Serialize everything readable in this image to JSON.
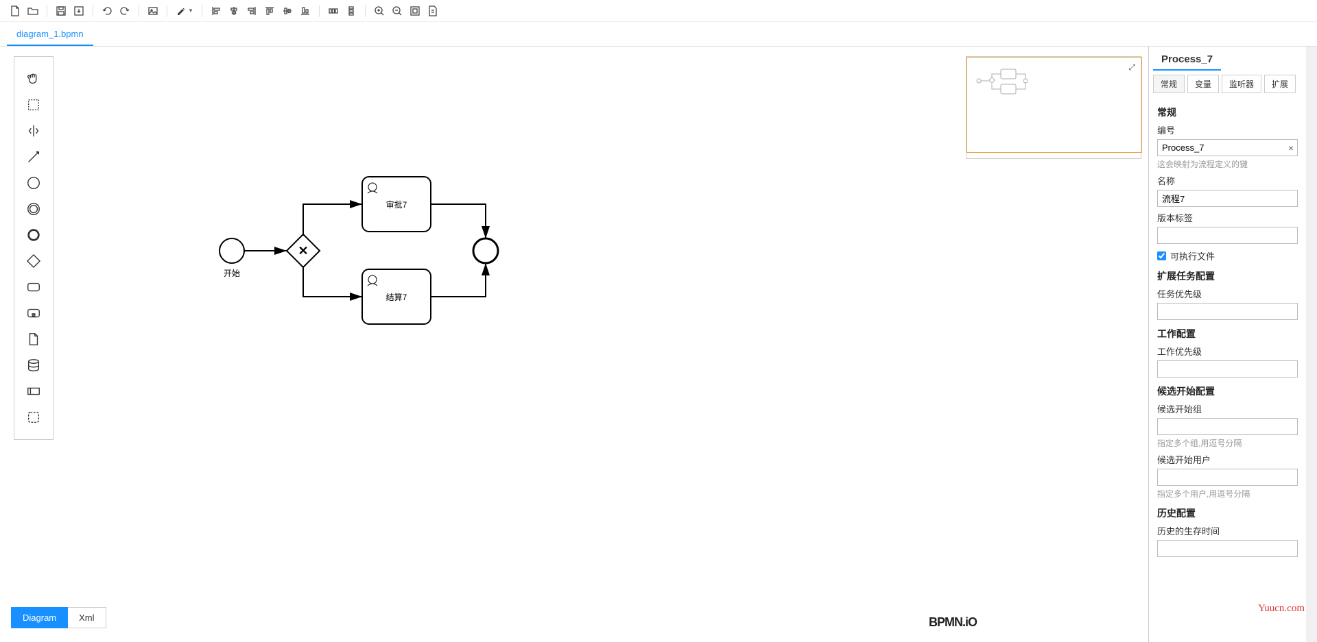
{
  "file_tab": "diagram_1.bpmn",
  "toolbar_icons": [
    "new-file",
    "open-file",
    "save",
    "download",
    "undo",
    "redo",
    "image",
    "paint",
    "align-left",
    "align-center-h",
    "align-right",
    "align-top",
    "align-center-v",
    "align-bottom",
    "distribute-h",
    "distribute-v",
    "zoom-in",
    "zoom-out",
    "fit",
    "page"
  ],
  "palette_icons": [
    "hand-tool",
    "lasso-tool",
    "space-tool",
    "connect-tool",
    "start-event",
    "intermediate-event",
    "end-event",
    "gateway",
    "task",
    "subprocess",
    "data-object",
    "data-store",
    "participant",
    "group"
  ],
  "bpmn": {
    "start_label": "开始",
    "task1": "审批7",
    "task2": "结算7"
  },
  "props": {
    "title": "Process_7",
    "tabs": [
      "常规",
      "变量",
      "监听器",
      "扩展"
    ],
    "h_general": "常规",
    "lbl_id": "编号",
    "val_id": "Process_7",
    "hint_id": "这会映射为流程定义的键",
    "lbl_name": "名称",
    "val_name": "流程7",
    "lbl_version": "版本标签",
    "lbl_exec": "可执行文件",
    "h_ext": "扩展任务配置",
    "lbl_task_prio": "任务优先级",
    "h_job": "工作配置",
    "lbl_job_prio": "工作优先级",
    "h_cand_start": "候选开始配置",
    "lbl_cand_group": "候选开始组",
    "hint_cand_group": "指定多个组,用逗号分隔",
    "lbl_cand_user": "候选开始用户",
    "hint_cand_user": "指定多个用户,用逗号分隔",
    "h_history": "历史配置",
    "lbl_ttl": "历史的生存时间"
  },
  "bottom_tabs": [
    "Diagram",
    "Xml"
  ],
  "logo": "BPMN.iO",
  "watermark": "Yuucn.com"
}
